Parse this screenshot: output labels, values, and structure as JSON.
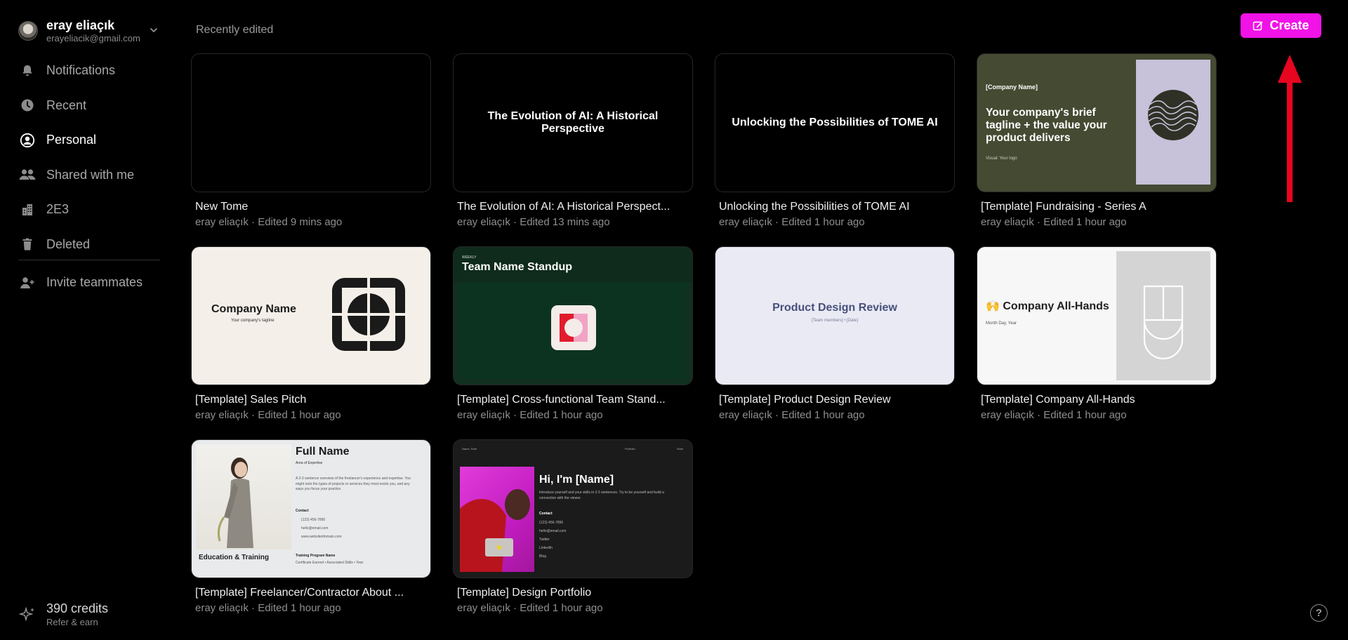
{
  "account": {
    "name": "eray eliaçık",
    "email": "erayeliacik@gmail.com"
  },
  "sidebar": {
    "items": [
      {
        "label": "Notifications",
        "icon": "bell-icon"
      },
      {
        "label": "Recent",
        "icon": "clock-icon"
      },
      {
        "label": "Personal",
        "icon": "user-circle-icon",
        "active": true
      },
      {
        "label": "Shared with me",
        "icon": "users-icon"
      },
      {
        "label": "2E3",
        "icon": "building-icon"
      },
      {
        "label": "Deleted",
        "icon": "trash-icon"
      }
    ],
    "invite": {
      "label": "Invite teammates",
      "icon": "user-plus-icon"
    }
  },
  "credits": {
    "label": "390 credits",
    "sub": "Refer & earn"
  },
  "header": {
    "section_title": "Recently edited",
    "create_label": "Create"
  },
  "colors": {
    "accent": "#f012e6",
    "arrow": "#e8051f",
    "background": "#000000"
  },
  "cards": [
    {
      "title": "New Tome",
      "meta": "eray eliaçık · Edited 9 mins ago"
    },
    {
      "title": "The Evolution of AI: A Historical Perspect...",
      "meta": "eray eliaçık · Edited 13 mins ago",
      "thumb_heading": "The Evolution of AI: A Historical Perspective"
    },
    {
      "title": "Unlocking the Possibilities of TOME AI",
      "meta": "eray eliaçık · Edited 1 hour ago",
      "thumb_heading": "Unlocking the Possibilities of TOME AI"
    },
    {
      "title": "[Template] Fundraising - Series A",
      "meta": "eray eliaçık · Edited 1 hour ago",
      "thumb_small": "[Company Name]",
      "thumb_heading": "Your company's brief tagline + the value your product delivers",
      "thumb_logo": "Visual: Your logo"
    },
    {
      "title": "[Template] Sales Pitch",
      "meta": "eray eliaçık · Edited 1 hour ago",
      "thumb_heading": "Company Name",
      "thumb_sub": "Your company's tagline"
    },
    {
      "title": "[Template] Cross-functional Team Stand...",
      "meta": "eray eliaçık · Edited 1 hour ago",
      "thumb_small": "WEEKLY",
      "thumb_heading": "Team Name Standup"
    },
    {
      "title": "[Template] Product Design Review",
      "meta": "eray eliaçık · Edited 1 hour ago",
      "thumb_heading": "Product Design Review",
      "thumb_sub": "[Team members] • [Date]"
    },
    {
      "title": "[Template] Company All-Hands",
      "meta": "eray eliaçık · Edited 1 hour ago",
      "thumb_heading": "🙌 Company All-Hands",
      "thumb_sub": "Month Day, Year"
    },
    {
      "title": "[Template] Freelancer/Contractor About ...",
      "meta": "eray eliaçık · Edited 1 hour ago",
      "thumb_heading": "Full Name",
      "thumb_area": "Area of Expertise",
      "thumb_para": "A 2-3 sentence overview of the freelancer's experience and expertise. You might note the types of projects or services they most excite you, and any ways you focus your practice.",
      "thumb_contact": "Contact",
      "thumb_contact_lines": [
        "(123) 456-7890",
        "hello@email.com",
        "www.website/domain.com"
      ],
      "thumb_training": "Training Program Name",
      "thumb_training_sub": "Certificate Earned • Associated Skills • Year",
      "thumb_edu": "Education & Training"
    },
    {
      "title": "[Template] Design Portfolio",
      "meta": "eray eliaçık · Edited 1 hour ago",
      "thumb_nav": [
        "Name, Role",
        "Portfolio",
        "Work"
      ],
      "thumb_heading": "Hi, I'm [Name]",
      "thumb_intro": "Introduce yourself and your skills in 2-3 sentences. Try to be yourself and build a connection with the viewer.",
      "thumb_contact": "Contact",
      "thumb_contact_lines": [
        "(123) 456-7890",
        "hello@email.com",
        "Twitter",
        "LinkedIn",
        "Blog"
      ]
    }
  ]
}
